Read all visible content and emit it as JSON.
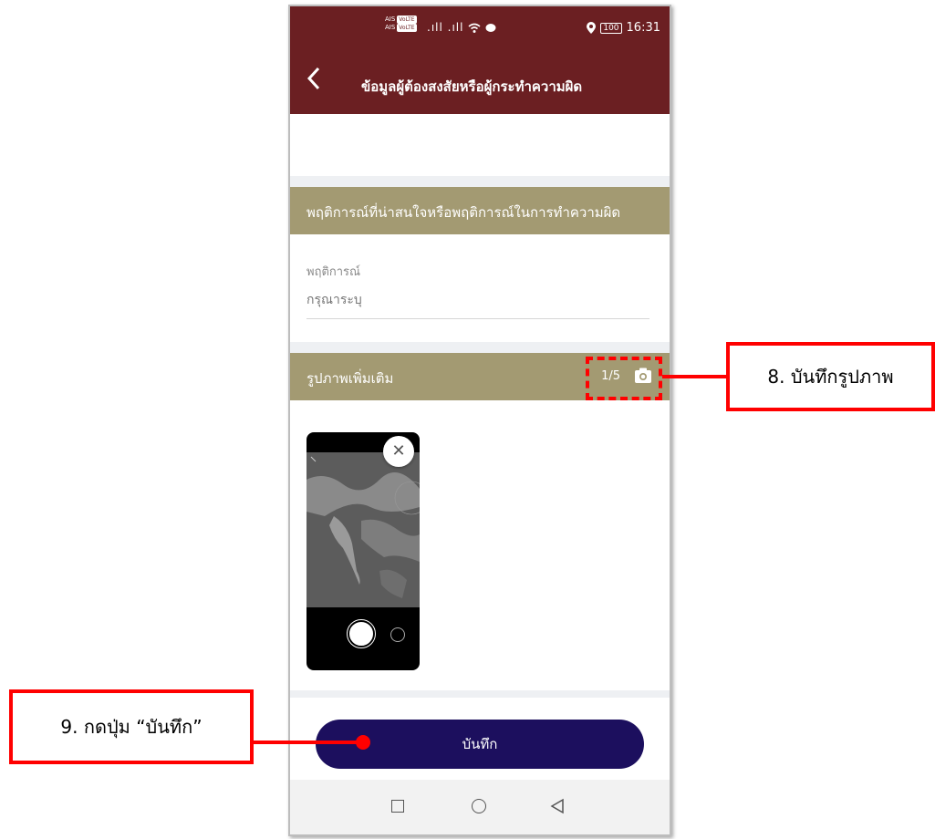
{
  "status_bar": {
    "carrier_1": "AIS",
    "carrier_2": "AIS",
    "volte": "VoLTE",
    "signal": ".ıll .ıll",
    "battery": "100",
    "time": "16:31"
  },
  "app_bar": {
    "back_icon": "chevron-left-icon",
    "title": "ข้อมูลผู้ต้องสงสัยหรือผู้กระทำความผิด"
  },
  "behavior_section": {
    "header": "พฤติการณ์ที่น่าสนใจหรือพฤติการณ์ในการทำความผิด",
    "field_label": "พฤติการณ์",
    "field_placeholder": "กรุณาระบุ"
  },
  "photos_section": {
    "header": "รูปภาพเพิ่มเติม",
    "count": "1/5",
    "camera_icon": "camera-icon",
    "remove_icon": "close-icon"
  },
  "save_button": {
    "label": "บันทึก"
  },
  "nav_bar": {
    "recents_icon": "square-icon",
    "home_icon": "circle-icon",
    "back_icon": "triangle-back-icon"
  },
  "annotations": {
    "step8": "8. บันทึกรูปภาพ",
    "step9": "9. กดปุ่ม “บันทึก”",
    "color": "#ff0000"
  },
  "colors": {
    "app_bar": "#6b1f22",
    "section_header": "#a39a72",
    "save_button": "#1c0f5e"
  }
}
